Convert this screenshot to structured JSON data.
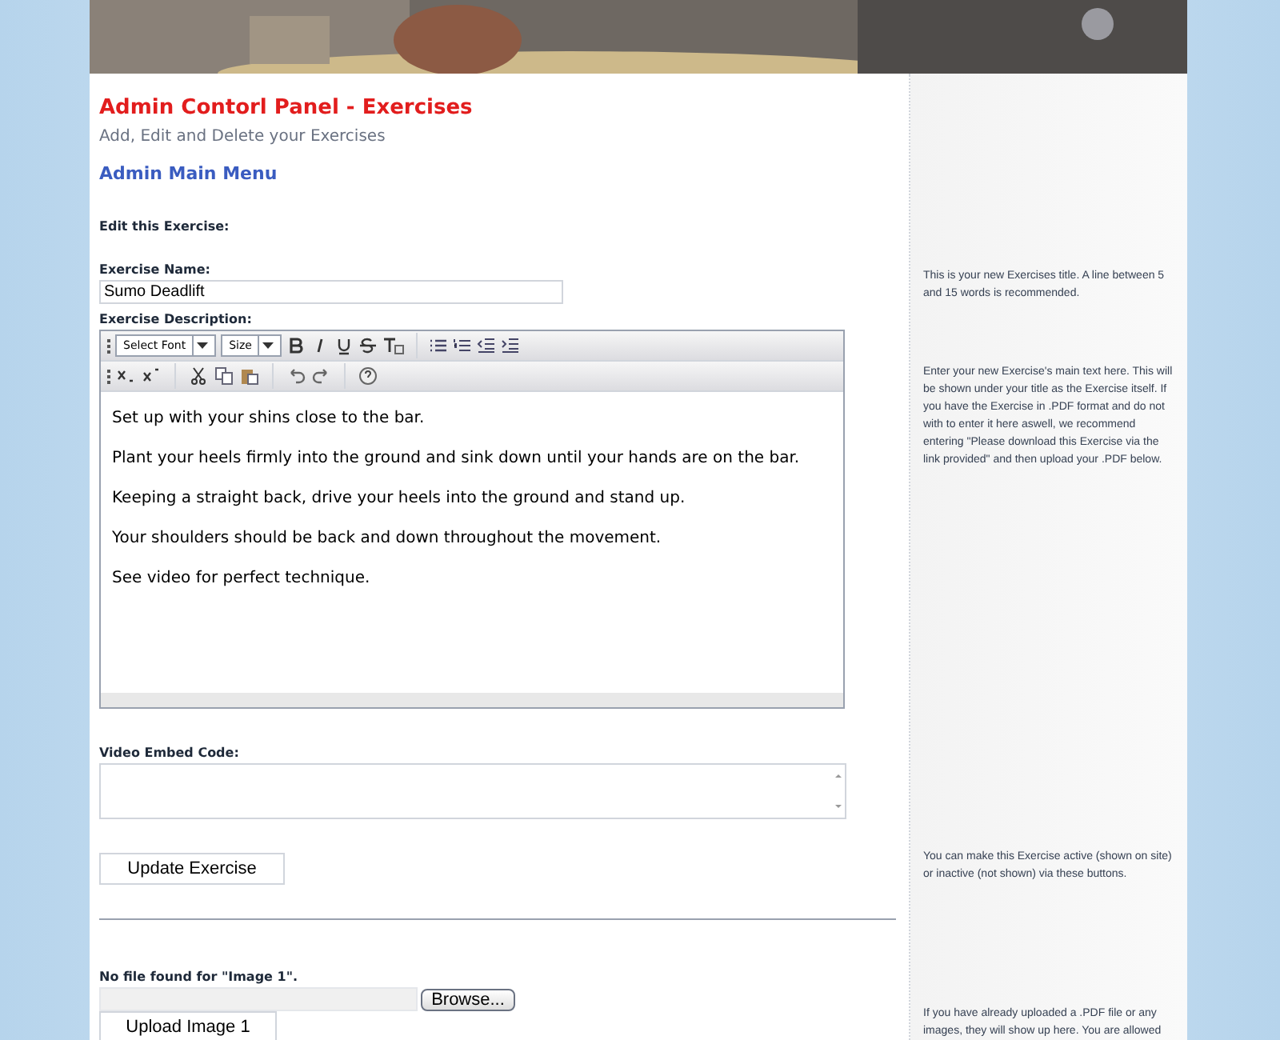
{
  "header": {
    "title": "Admin Contorl Panel - Exercises",
    "subtitle": "Add, Edit and Delete your Exercises",
    "menu_link": "Admin Main Menu"
  },
  "form": {
    "section_title": "Edit this Exercise:",
    "name_label": "Exercise Name:",
    "name_value": "Sumo Deadlift",
    "description_label": "Exercise Description:",
    "toolbar": {
      "font_select": "Select Font",
      "size_select": "Size"
    },
    "description_paragraphs": [
      "Set up with your shins close to the bar.",
      "Plant your heels firmly into the ground and sink down until your hands are on the bar.",
      "Keeping a straight back, drive your heels into the ground and stand up.",
      "Your shoulders should be back and down throughout the movement.",
      "See video for perfect technique."
    ],
    "video_label": "Video Embed Code:",
    "update_button": "Update Exercise",
    "upload_message": "No file found for \"Image 1\".",
    "browse_button": "Browse...",
    "upload_button": "Upload Image 1"
  },
  "help": [
    "This is your new Exercises title. A line between 5 and 15 words is recommended.",
    "Enter your new Exercise's main text here. This will be shown under your title as the Exercise itself. If you have the Exercise in .PDF format and do not with to enter it here aswell, we recommend entering \"Please download this Exercise via the link provided\" and then upload your .PDF below.",
    "You can make this Exercise active (shown on site) or inactive (not shown) via these buttons.",
    "If you have already uploaded a .PDF file or any images, they will show up here. You are allowed"
  ]
}
